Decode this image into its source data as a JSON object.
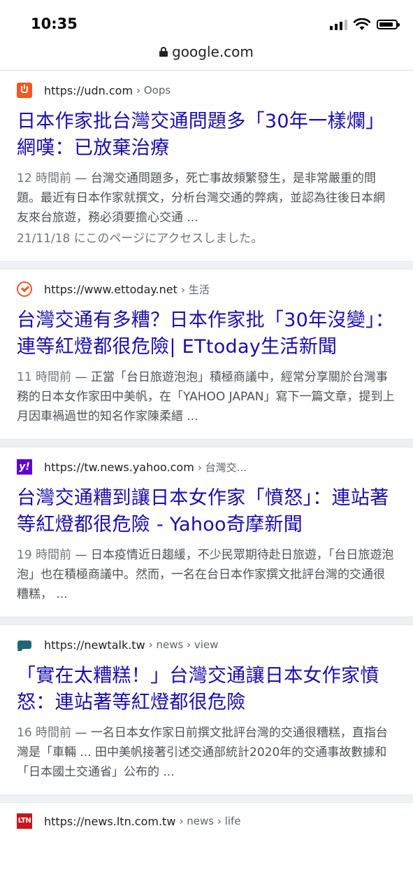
{
  "status_bar": {
    "time": "10:35",
    "battery_level": 0.85,
    "signal_bars": 3
  },
  "address_bar": {
    "domain": "google.com"
  },
  "results": [
    {
      "source_url": "https://udn.com",
      "source_path": "› Oops",
      "favicon": "udn-icon",
      "title": "日本作家批台灣交通問題多「30年一樣爛」 網嘆：已放棄治療",
      "date": "12 時間前",
      "snippet": "台灣交通問題多，死亡事故頻繁發生，是非常嚴重的問題。最近有日本作家就撰文，分析台灣交通的弊病，並認為往後日本網友來台旅遊，務必須要擔心交通 ...",
      "visited": "21/11/18 にこのページにアクセスしました。"
    },
    {
      "source_url": "https://www.ettoday.net",
      "source_path": "› 生活",
      "favicon": "ettoday-icon",
      "title": "台灣交通有多糟？日本作家批「30年沒變」：連等紅燈都很危險| ETtoday生活新聞",
      "date": "11 時間前",
      "snippet": "正當「台日旅遊泡泡」積極商議中，經常分享關於台灣事務的日本女作家田中美帆，在「YAHOO JAPAN」寫下一篇文章，提到上月因車禍過世的知名作家陳柔縉 ...",
      "visited": ""
    },
    {
      "source_url": "https://tw.news.yahoo.com",
      "source_path": "› 台灣交...",
      "favicon": "yahoo-icon",
      "favicon_text": "y!",
      "title": "台灣交通糟到讓日本女作家「憤怒」：連站著等紅燈都很危險 - Yahoo奇摩新聞",
      "date": "19 時間前",
      "snippet": "日本疫情近日趨緩，不少民眾期待赴日旅遊，「台日旅遊泡泡」也在積極商議中。然而，一名在台日本作家撰文批評台灣的交通很糟糕， ...",
      "visited": ""
    },
    {
      "source_url": "https://newtalk.tw",
      "source_path": "› news › view",
      "favicon": "newtalk-icon",
      "title": "「實在太糟糕！」台灣交通讓日本女作家憤怒：連站著等紅燈都很危險",
      "date": "16 時間前",
      "snippet": "一名日本女作家日前撰文批評台灣的交通很糟糕，直指台灣是「車輛 ... 田中美帆接著引述交通部統計2020年的交通事故數據和「日本國土交通省」公布的 ...",
      "visited": ""
    }
  ],
  "partial_result": {
    "source_url": "https://news.ltn.com.tw",
    "source_path": "› news › life",
    "favicon": "ltn-icon",
    "favicon_text": "LTN"
  }
}
